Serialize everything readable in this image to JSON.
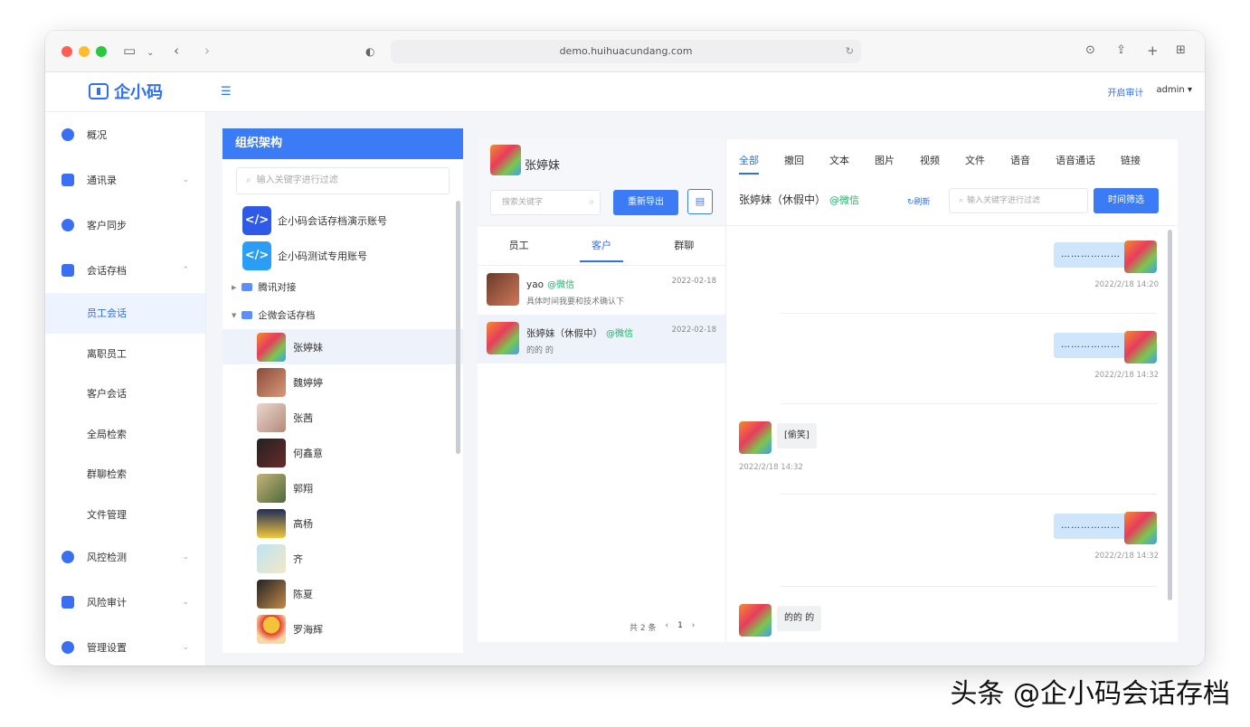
{
  "browser": {
    "url": "demo.huihuacundang.com"
  },
  "app": {
    "logo_text": "企小码",
    "header_audit": "开启审计",
    "header_user": "admin",
    "header_user_caret": "▾"
  },
  "sidebar": {
    "items": [
      {
        "label": "概况"
      },
      {
        "label": "通讯录",
        "chev": "⌄"
      },
      {
        "label": "客户同步"
      },
      {
        "label": "会话存档",
        "chev": "⌃"
      }
    ],
    "subitems": [
      {
        "label": "员工会话"
      },
      {
        "label": "离职员工"
      },
      {
        "label": "客户会话"
      },
      {
        "label": "全局检索"
      },
      {
        "label": "群聊检索"
      },
      {
        "label": "文件管理"
      }
    ],
    "bottom_items": [
      {
        "label": "风控检测",
        "chev": "⌄"
      },
      {
        "label": "风险审计",
        "chev": "⌄"
      },
      {
        "label": "管理设置",
        "chev": "⌄"
      }
    ]
  },
  "org": {
    "title": "组织架构",
    "search_placeholder": "输入关键字进行过滤",
    "accounts": [
      {
        "label": "企小码会话存档演示账号"
      },
      {
        "label": "企小码测试专用账号"
      }
    ],
    "folders": [
      {
        "label": "腾讯对接"
      },
      {
        "label": "企微会话存档"
      }
    ],
    "members": [
      {
        "label": "张婷妹"
      },
      {
        "label": "魏婷婷"
      },
      {
        "label": "张茜"
      },
      {
        "label": "何鑫意"
      },
      {
        "label": "郭翔"
      },
      {
        "label": "高杨"
      },
      {
        "label": "齐"
      },
      {
        "label": "陈夏"
      },
      {
        "label": "罗海辉"
      }
    ]
  },
  "middle": {
    "contact_name": "张婷妹",
    "search_placeholder": "搜索关键字",
    "export_label": "重新导出",
    "tabs": [
      "员工",
      "客户",
      "群聊"
    ],
    "conversations": [
      {
        "name": "yao",
        "tag": "@微信",
        "date": "2022-02-18",
        "preview": "具体时间我要和技术确认下"
      },
      {
        "name": "张婷妹（休假中）",
        "tag": "@微信",
        "date": "2022-02-18",
        "preview": "的的 的"
      }
    ],
    "pager_total": "共 2 条",
    "pager_page": "1"
  },
  "right": {
    "tabs": [
      "全部",
      "撤回",
      "文本",
      "图片",
      "视频",
      "文件",
      "语音",
      "语音通话",
      "链接"
    ],
    "who": "张婷妹（休假中）",
    "who_tag": "@微信",
    "refresh_label": "刷新",
    "search_placeholder": "输入关键字进行过滤",
    "filter_label": "时间筛选",
    "messages": [
      {
        "dir": "out",
        "text": "………………",
        "time": "2022/2/18 14:20"
      },
      {
        "dir": "out",
        "text": "………………",
        "time": "2022/2/18 14:32"
      },
      {
        "dir": "in",
        "text": "[偷笑]",
        "time": "2022/2/18 14:32"
      },
      {
        "dir": "out",
        "text": "………………",
        "time": "2022/2/18 14:32"
      },
      {
        "dir": "in",
        "text": "的的 的",
        "time": ""
      }
    ]
  },
  "watermark": "头条 @企小码会话存档"
}
